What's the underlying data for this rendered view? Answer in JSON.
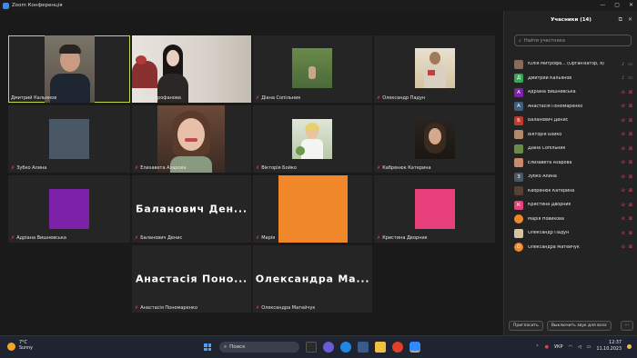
{
  "window": {
    "title": "Zoom Конференція",
    "controls": [
      "—",
      "▢",
      "✕"
    ]
  },
  "meeting": {
    "tiles": [
      {
        "name": "Дмитрий Кальянов",
        "mic_off": false,
        "active": true
      },
      {
        "name": "Юлія Митрофанова",
        "mic_off": false
      },
      {
        "name": "Діана Сопільник",
        "mic_off": true
      },
      {
        "name": "Олександр Падун",
        "mic_off": true
      },
      {
        "name": "Зубко Алина",
        "mic_off": true,
        "avatar_color": "#4a5866"
      },
      {
        "name": "Елизавета Азарова",
        "mic_off": true
      },
      {
        "name": "Вікторія Бойко",
        "mic_off": true
      },
      {
        "name": "Кабренюк Катерина",
        "mic_off": true
      },
      {
        "name": "Адріана Вишневська",
        "mic_off": true,
        "avatar_color": "#7b22a8"
      },
      {
        "name": "Баланович Денис",
        "mic_off": true,
        "display": "Баланович  Ден..."
      },
      {
        "name": "Марія Новикова",
        "mic_off": true,
        "display_short": "Марія",
        "avatar_color": "#f0882a"
      },
      {
        "name": "Кристина Дворник",
        "mic_off": true,
        "avatar_color": "#e8407a"
      },
      {
        "name": "Анастасія Пономаренко",
        "mic_off": true,
        "display": "Анастасія  Поно..."
      },
      {
        "name": "Олександра Матейчук",
        "mic_off": true,
        "display": "Олександра  Ма..."
      }
    ]
  },
  "panel": {
    "title": "Учасники (14)",
    "search_placeholder": "Найти участника",
    "participants": [
      {
        "name": "Юлія Митрофа...   (Організатор, я)",
        "avatar": "",
        "color": "#8a6a5a",
        "photo": true,
        "mic": "on",
        "cam": "on"
      },
      {
        "name": "Дмитрий Кальянов",
        "avatar": "Д",
        "color": "#3aa35a",
        "mic": "on",
        "cam": "on"
      },
      {
        "name": "Адріана Вишневська",
        "avatar": "А",
        "color": "#7b22a8",
        "mic": "off",
        "cam": "off"
      },
      {
        "name": "Анастасія Пономаренко",
        "avatar": "А",
        "color": "#3f5f7a",
        "mic": "off",
        "cam": "off"
      },
      {
        "name": "Баланович Денис",
        "avatar": "Б",
        "color": "#c0392b",
        "mic": "off",
        "cam": "off"
      },
      {
        "name": "Вікторія Бойко",
        "avatar": "",
        "color": "#b08a6a",
        "photo": true,
        "mic": "off",
        "cam": "off"
      },
      {
        "name": "Діана Сопільник",
        "avatar": "",
        "color": "#6a8a4a",
        "photo": true,
        "mic": "off",
        "cam": "off"
      },
      {
        "name": "Елизавета Азарова",
        "avatar": "",
        "color": "#c98a70",
        "photo": true,
        "mic": "off",
        "cam": "off"
      },
      {
        "name": "Зубко Алина",
        "avatar": "З",
        "color": "#4a5866",
        "mic": "off",
        "cam": "off"
      },
      {
        "name": "Кабренюк Катерина",
        "avatar": "",
        "color": "#5a4030",
        "photo": true,
        "mic": "off",
        "cam": "off"
      },
      {
        "name": "Кристина Дворник",
        "avatar": "К",
        "color": "#e8407a",
        "mic": "off",
        "cam": "off"
      },
      {
        "name": "Марія Новикова",
        "avatar": "",
        "color": "#f0882a",
        "circle": true,
        "mic": "off",
        "cam": "off"
      },
      {
        "name": "Олександр Падун",
        "avatar": "",
        "color": "#d6c4a0",
        "photo": true,
        "mic": "off",
        "cam": "off"
      },
      {
        "name": "Олександра Матейчук",
        "avatar": "О",
        "color": "#f0882a",
        "circle": true,
        "mic": "off",
        "cam": "off"
      }
    ],
    "invite_label": "Пригласить",
    "mute_all_label": "Выключить звук для всех",
    "more_label": "···"
  },
  "taskbar": {
    "weather_temp": "7°C",
    "weather_desc": "Sunny",
    "search_label": "Поиск",
    "lang": "УКР",
    "time": "12:37",
    "date": "11.10.2023"
  }
}
